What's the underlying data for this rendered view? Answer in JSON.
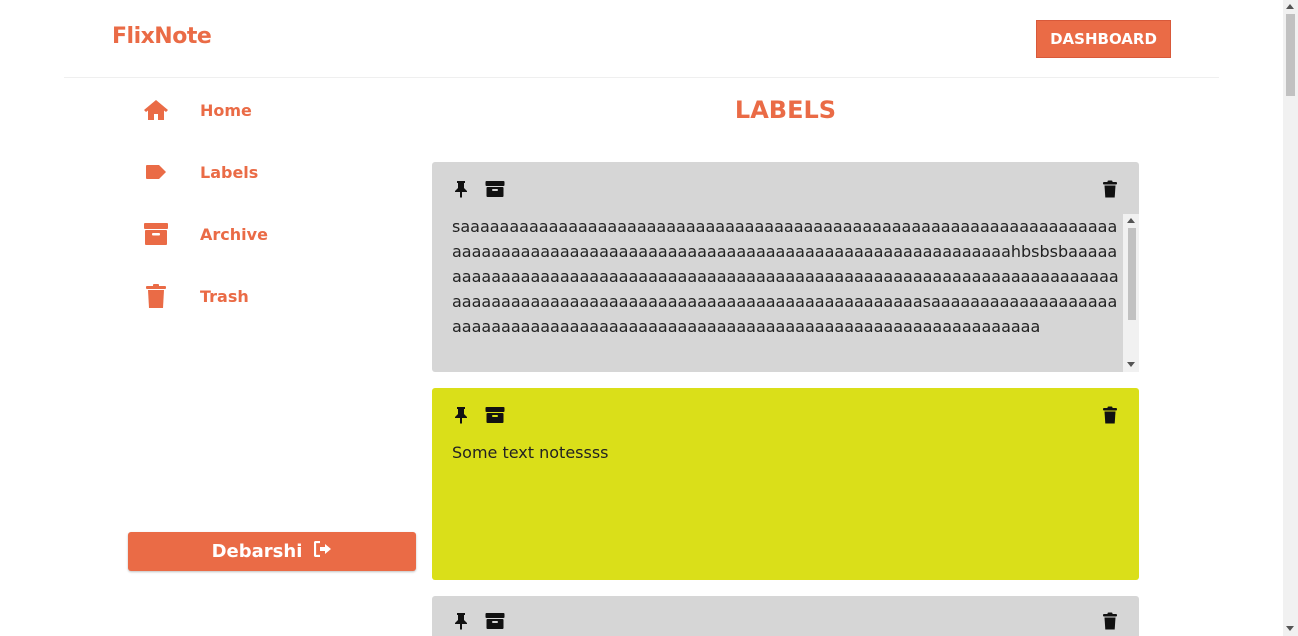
{
  "header": {
    "brand": "FlixNote",
    "dashboard_label": "DASHBOARD"
  },
  "sidebar": {
    "items": [
      {
        "label": "Home",
        "icon": "home-icon"
      },
      {
        "label": "Labels",
        "icon": "tag-icon"
      },
      {
        "label": "Archive",
        "icon": "archive-icon"
      },
      {
        "label": "Trash",
        "icon": "trash-icon"
      }
    ],
    "user_label": "Debarshi",
    "logout_icon": "logout-icon"
  },
  "main": {
    "title": "LABELS",
    "notes": [
      {
        "background": "#d6d6d6",
        "text": "saaaaaaaaaaaaaaaaaaaaaaaaaaaaaaaaaaaaaaaaaaaaaaaaaaaaaaaaaaaaaaaaaaaaaaaaaaaaaaaaaaaaaaaaaaaaaaaaaaaaaaaaaaaaaaaaaaaaaaaaaaaahbsbsbaaaaaaaaaaaaaaaaaaaaaaaaaaaaaaaaaaaaaaaaaaaaaaaaaaaaaaaaaaaaaaaaaaaaaaaaaaaaaaaaaaaaaaaaaaaaaaaaaaaaaaaaaaaaaaaaaaaaaaaaasaaaaaaaaaaaaaaaaaaaaaaaaaaaaaaaaaaaaaaaaaaaaaaaaaaaaaaaaaaaaaaaaaaaaaaaaaaaaaaa"
      },
      {
        "background": "#dadf19",
        "text": "Some text notessss"
      },
      {
        "background": "#d6d6d6",
        "text": ""
      }
    ]
  },
  "colors": {
    "accent": "#ea6b46",
    "note_gray": "#d6d6d6",
    "note_yellow": "#dadf19"
  }
}
